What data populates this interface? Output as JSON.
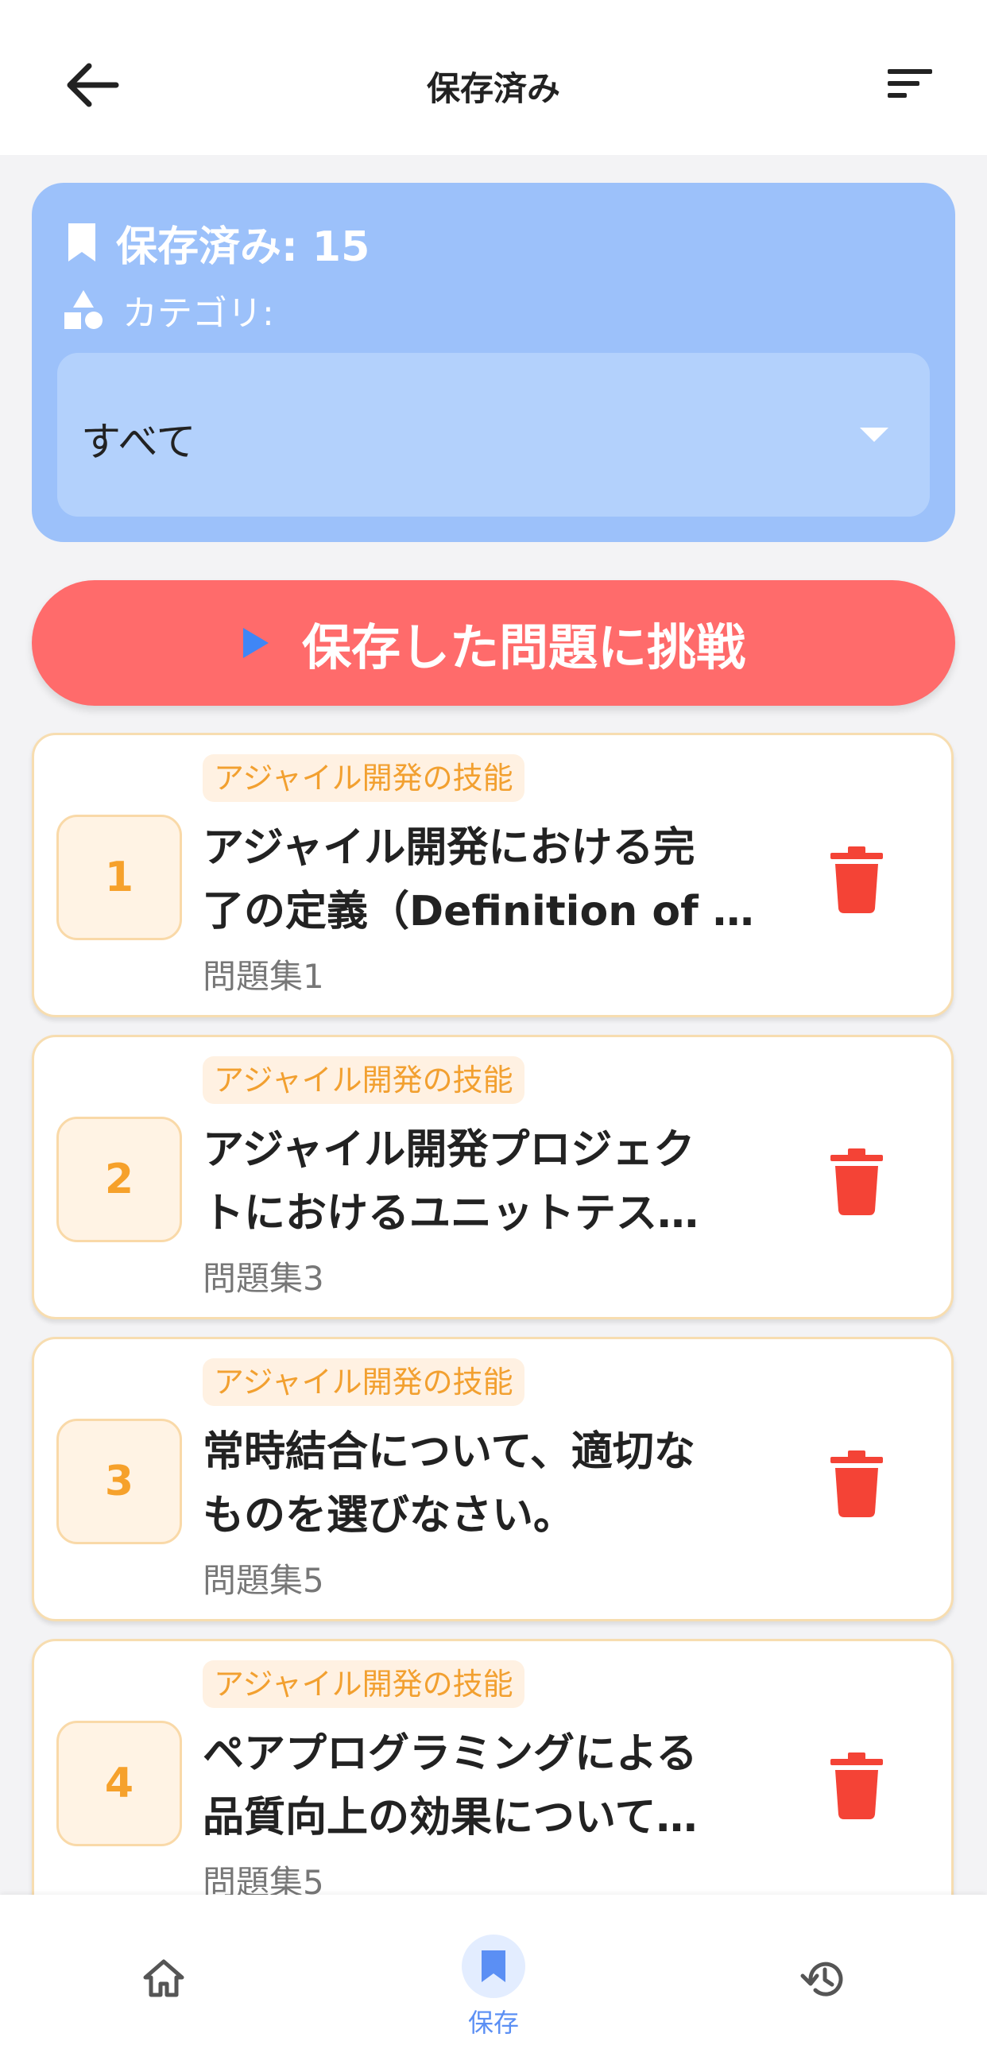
{
  "header": {
    "title": "保存済み"
  },
  "summary": {
    "saved_label": "保存済み: 15",
    "category_label": "カテゴリ:",
    "category_selected": "すべて"
  },
  "challenge_button": {
    "label": "保存した問題に挑戦"
  },
  "questions": [
    {
      "number": "1",
      "tag": "アジャイル開発の技能",
      "title": "アジャイル開発における完\n了の定義（Definition of …",
      "set": "問題集1"
    },
    {
      "number": "2",
      "tag": "アジャイル開発の技能",
      "title": "アジャイル開発プロジェク\nトにおけるユニットテス…",
      "set": "問題集3"
    },
    {
      "number": "3",
      "tag": "アジャイル開発の技能",
      "title": "常時結合について、適切な\nものを選びなさい。",
      "set": "問題集5"
    },
    {
      "number": "4",
      "tag": "アジャイル開発の技能",
      "title": "ペアプログラミングによる\n品質向上の効果について…",
      "set": "問題集5"
    }
  ],
  "bottom_nav": {
    "saved_label": "保存"
  },
  "colors": {
    "accent": "#5b8ff4",
    "danger": "#f44336",
    "challenge": "#ff6b6b",
    "tag": "#f2a030"
  },
  "icons": [
    "back-arrow-icon",
    "sort-icon",
    "bookmark-icon",
    "shapes-icon",
    "caret-down-icon",
    "play-icon",
    "trash-icon",
    "home-icon",
    "history-icon"
  ]
}
